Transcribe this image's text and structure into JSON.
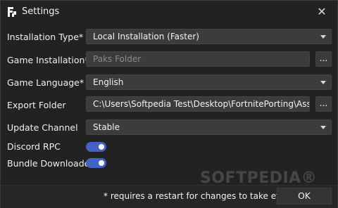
{
  "window": {
    "title": "Settings",
    "logo_icon": "fortniteporting-logo-icon",
    "close_glyph": "✕"
  },
  "fields": [
    {
      "label": "Installation Type*",
      "type": "select",
      "value": "Local Installation (Faster)"
    },
    {
      "label": "Game Installation*",
      "type": "text",
      "placeholder": "Paks Folder",
      "value": "",
      "browse": "..."
    },
    {
      "label": "Game Language*",
      "type": "select",
      "value": "English"
    },
    {
      "label": "Export Folder",
      "type": "text",
      "value": "C:\\Users\\Softpedia Test\\Desktop\\FortnitePorting\\Assets",
      "browse": "..."
    },
    {
      "label": "Update Channel",
      "type": "select",
      "value": "Stable"
    },
    {
      "label": "Discord RPC",
      "type": "toggle",
      "on": true
    },
    {
      "label": "Bundle Downloader",
      "type": "toggle",
      "on": true
    }
  ],
  "footer": {
    "note": "* requires a restart for changes to take effect",
    "ok_label": "OK"
  },
  "watermark": "SOFTPEDIA®",
  "colors": {
    "accent": "#4263c4",
    "background": "#222222",
    "field": "#3c3c3c"
  }
}
